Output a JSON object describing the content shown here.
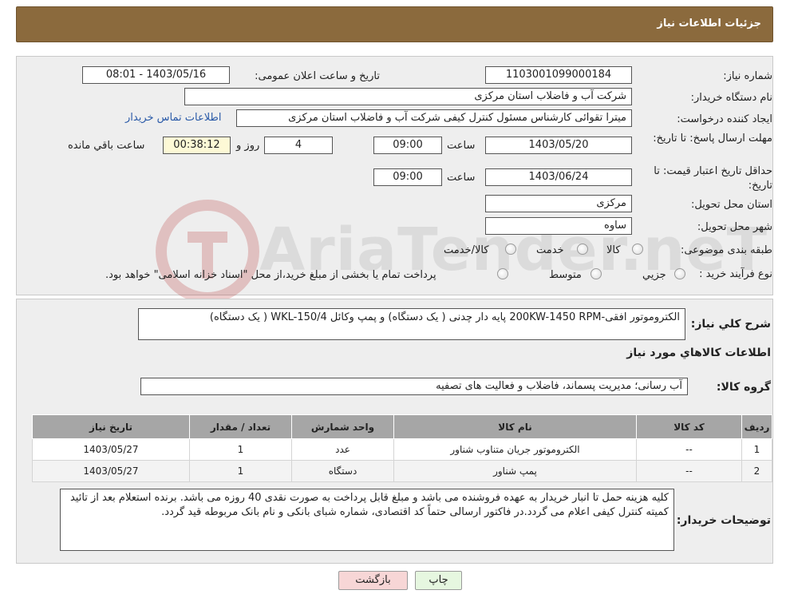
{
  "header": {
    "title": "جزئیات اطلاعات نیاز"
  },
  "form": {
    "need_number_label": "شماره نیاز:",
    "need_number": "1103001099000184",
    "announce_label": "تاریخ و ساعت اعلان عمومی:",
    "announce_value": "1403/05/16 - 08:01",
    "buyer_org_label": "نام دستگاه خریدار:",
    "buyer_org": "شرکت آب و فاضلاب استان مرکزی",
    "creator_label": "ایجاد کننده درخواست:",
    "creator": "میترا تقوائی کارشناس مسئول کنترل کیفی شرکت آب و فاضلاب استان مرکزی",
    "contact_link": "اطلاعات تماس خریدار",
    "reply_deadline_label": "مهلت ارسال پاسخ: تا تاریخ:",
    "reply_date": "1403/05/20",
    "time_label": "ساعت",
    "reply_time": "09:00",
    "days_value": "4",
    "days_label": "روز و",
    "remaining_time": "00:38:12",
    "remaining_label": "ساعت باقي مانده",
    "price_validity_label": "حداقل تاریخ اعتبار قیمت: تا تاریخ:",
    "price_date": "1403/06/24",
    "price_time": "09:00",
    "province_label": "استان محل تحویل:",
    "province": "مرکزی",
    "city_label": "شهر محل تحویل:",
    "city": "ساوه",
    "category_label": "طبقه بندی موضوعی:",
    "category_options": [
      "کالا",
      "خدمت",
      "کالا/خدمت"
    ],
    "process_label": "نوع فرآیند خرید :",
    "process_options": [
      "جزيي",
      "متوسط"
    ],
    "process_note": "پرداخت تمام یا بخشی از مبلغ خرید،از محل \"اسناد خزانه اسلامی\" خواهد بود."
  },
  "description": {
    "label": "شرح كلي نياز:",
    "text": "الکتروموتور افقی-200KW-1450 RPM پایه دار چدنی ( یک دستگاه) و پمپ وکائل WKL-150/4 ( یک دستگاه)",
    "goods_info_title": "اطلاعات كالاهاي مورد نياز",
    "group_label": "گروه كالا:",
    "group_value": "آب رسانی؛ مدیریت پسماند، فاضلاب و فعالیت های تصفیه"
  },
  "table": {
    "headers": [
      "رديف",
      "كد كالا",
      "نام كالا",
      "واحد شمارش",
      "تعداد / مقدار",
      "تاريخ نياز"
    ],
    "rows": [
      [
        "1",
        "--",
        "الکتروموتور جریان متناوب شناور",
        "عدد",
        "1",
        "1403/05/27"
      ],
      [
        "2",
        "--",
        "پمپ شناور",
        "دستگاه",
        "1",
        "1403/05/27"
      ]
    ]
  },
  "buyer_notes": {
    "label": "توضيحات خريدار:",
    "text": "کلیه هزینه حمل تا انبار خریدار به عهده فروشنده می باشد و مبلغ قابل پرداخت به صورت نقدی 40 روزه می باشد. برنده استعلام بعد از تائید کمیته کنترل کیفی اعلام می گردد.در فاکتور ارسالی حتماً کد اقتصادی، شماره شبای بانکی و نام بانک مربوطه قید گردد."
  },
  "buttons": {
    "print": "چاپ",
    "back": "بازگشت"
  },
  "watermark": {
    "text": "AriaTender.neT"
  },
  "colors": {
    "header": "#8b6a3d",
    "back_button": "#f7d6d6",
    "print_button": "#e6f7e0",
    "link": "#2a5aa8"
  }
}
